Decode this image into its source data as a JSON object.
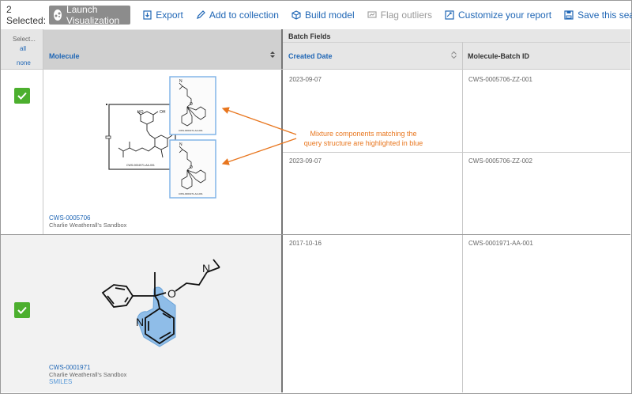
{
  "toolbar": {
    "selected_count": "2 Selected:",
    "launch_label": "Launch Visualization",
    "export_label": "Export",
    "add_collection_label": "Add to collection",
    "build_model_label": "Build model",
    "flag_outliers_label": "Flag outliers",
    "customize_label": "Customize your report",
    "save_search_label": "Save this search"
  },
  "header": {
    "select_label": "Select...",
    "select_all": "all",
    "select_none": "none",
    "molecule_col": "Molecule",
    "batch_fields": "Batch Fields",
    "created_date_col": "Created Date",
    "batch_id_col": "Molecule-Batch ID"
  },
  "rows": [
    {
      "molecule_id": "CWS-0005706",
      "owner": "Charlie Weatherall's Sandbox",
      "batches": [
        {
          "date": "2023-09-07",
          "batch_id": "CWS-0005706-ZZ-001"
        },
        {
          "date": "2023-09-07",
          "batch_id": "CWS-0005706-ZZ-002"
        }
      ]
    },
    {
      "molecule_id": "CWS-0001971",
      "owner": "Charlie Weatherall's Sandbox",
      "smiles_link": "SMILES",
      "batches": [
        {
          "date": "2017-10-16",
          "batch_id": "CWS-0001971-AA-001"
        }
      ]
    }
  ],
  "annotation": {
    "line1": "Mixture components matching the",
    "line2": "query structure are highlighted in blue"
  },
  "colors": {
    "accent_blue": "#1f66b5",
    "check_green": "#4caf2e",
    "highlight_blue": "#8fbde8",
    "annotation_orange": "#e8761e"
  }
}
